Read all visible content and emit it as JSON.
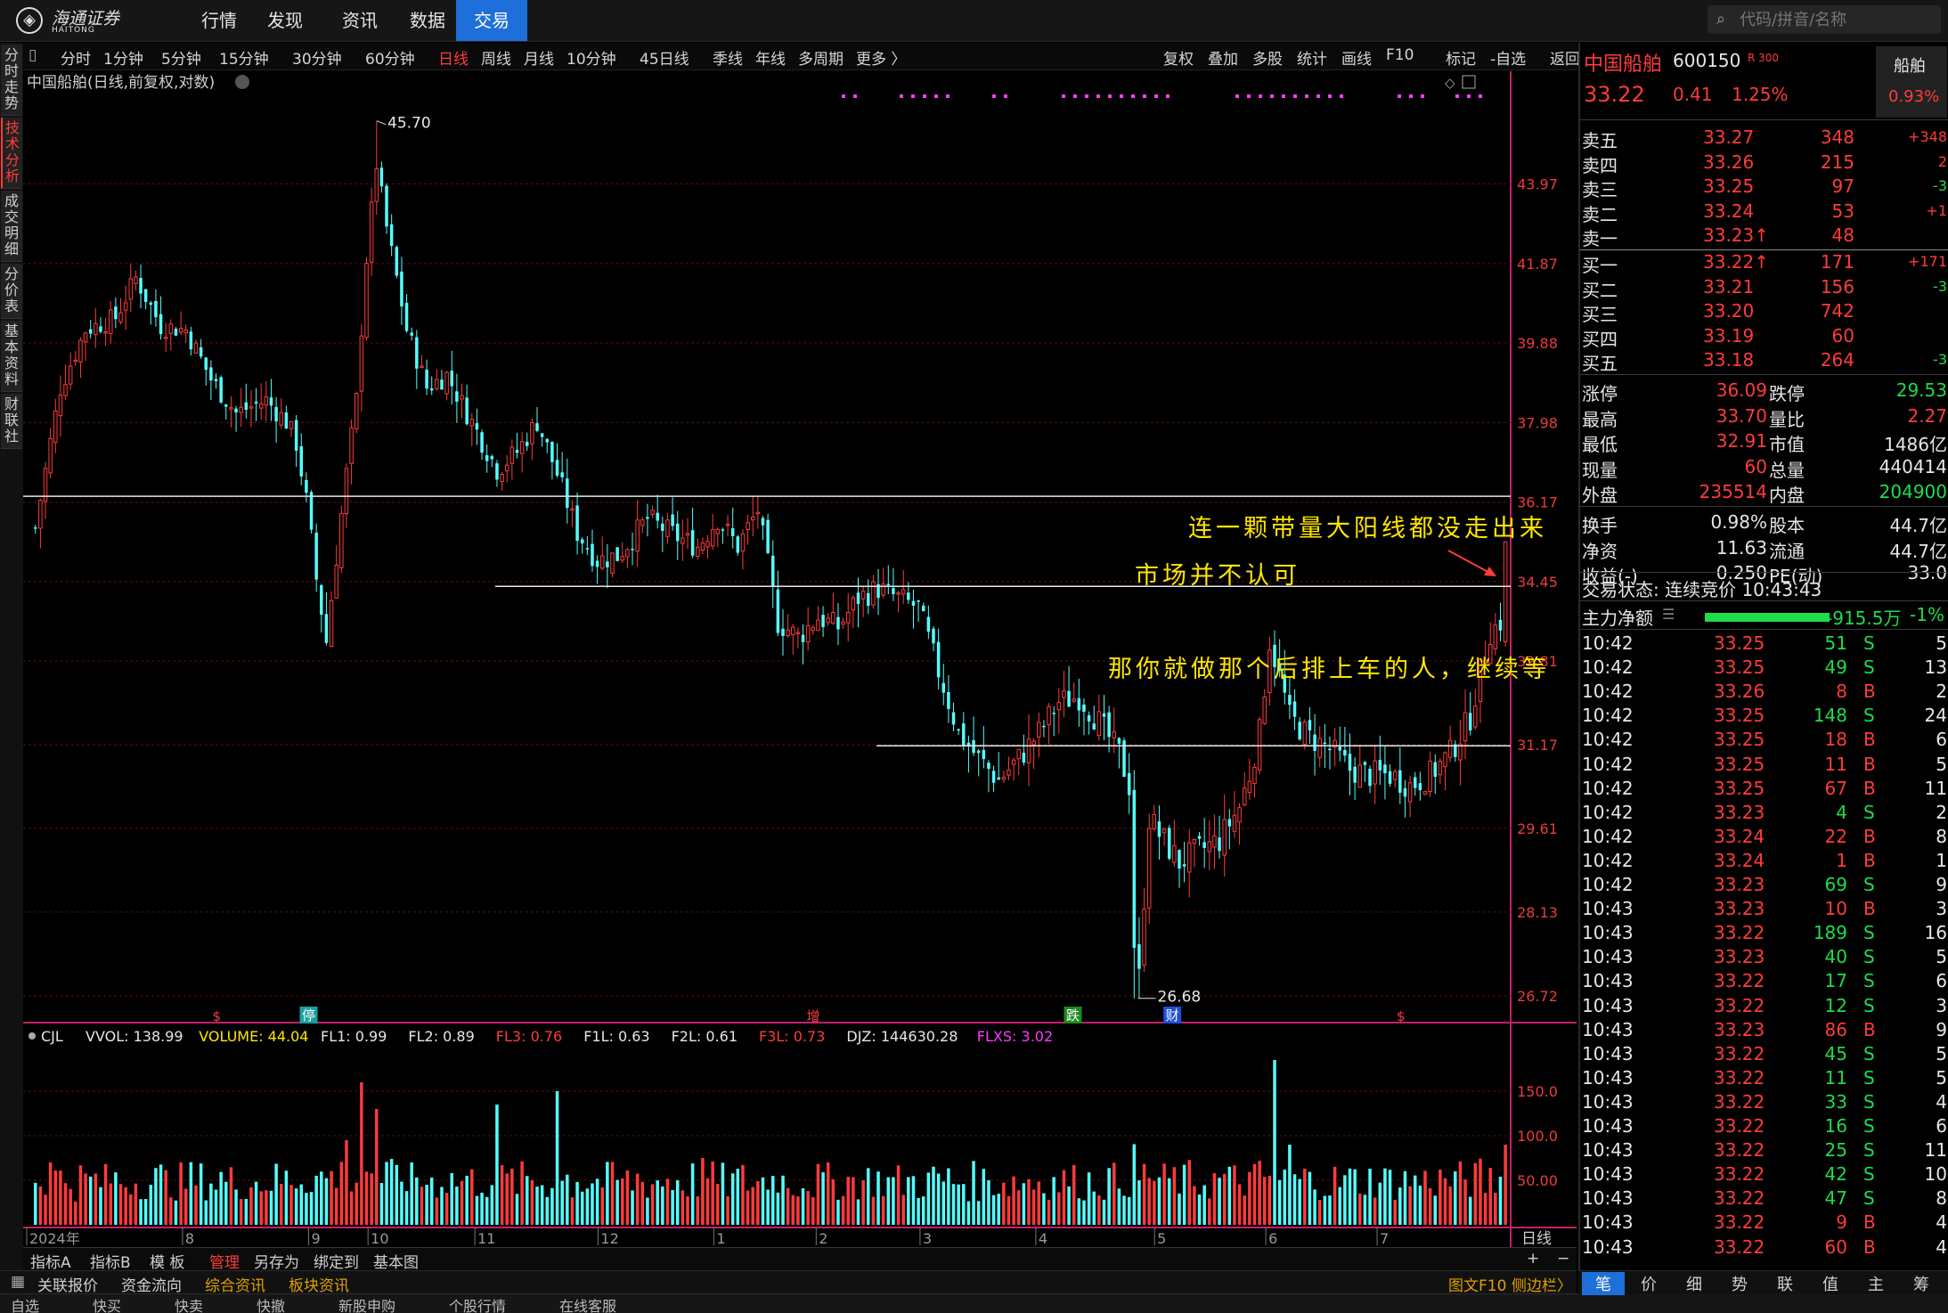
{
  "app": {
    "logo_cn": "海通证券",
    "logo_en": "HAITONG",
    "nav": [
      "行情",
      "发现",
      "资讯",
      "数据",
      "交易"
    ],
    "active_nav": 4,
    "search_placeholder": "代码/拼音/名称"
  },
  "left_tabs": [
    {
      "label": "分时走势",
      "active": false
    },
    {
      "label": "技术分析",
      "active": true
    },
    {
      "label": "成交明细",
      "active": false
    },
    {
      "label": "分价表",
      "active": false
    },
    {
      "label": "基本资料",
      "active": false
    },
    {
      "label": "财联社",
      "active": false
    }
  ],
  "period_toolbar": {
    "left": [
      "分时",
      "1分钟",
      "5分钟",
      "15分钟",
      "30分钟",
      "60分钟",
      "日线",
      "周线",
      "月线",
      "10分钟",
      "45日线",
      "季线",
      "年线",
      "多周期",
      "更多 〉"
    ],
    "active": "日线",
    "right": [
      "复权",
      "叠加",
      "多股",
      "统计",
      "画线",
      "F10",
      "标记",
      "-自选",
      "返回"
    ]
  },
  "chart_header": "中国船舶(日线,前复权,对数)",
  "price_axis": [
    "43.97",
    "41.87",
    "39.88",
    "37.98",
    "36.17",
    "34.45",
    "32.81",
    "31.17",
    "29.61",
    "28.13",
    "26.72"
  ],
  "high_label": "45.70",
  "low_label": "26.68",
  "h_lines": [
    36.3,
    34.35,
    31.15
  ],
  "signals": [
    {
      "text": "$",
      "x": 0.128,
      "kind": "red"
    },
    {
      "text": "停",
      "x": 0.19,
      "kind": "teal"
    },
    {
      "text": "增",
      "x": 0.53,
      "kind": "red"
    },
    {
      "text": "跌",
      "x": 0.705,
      "kind": "green"
    },
    {
      "text": "财",
      "x": 0.772,
      "kind": "blue"
    },
    {
      "text": "$",
      "x": 0.926,
      "kind": "red"
    }
  ],
  "annotations": [
    "连一颗带量大阳线都没走出来",
    "市场并不认可",
    "那你就做那个后排上车的人，继续等"
  ],
  "indicator": {
    "title": "CJL",
    "items": [
      {
        "label": "VVOL: 138.99",
        "color": "#e6e6e6"
      },
      {
        "label": "VOLUME: 44.04",
        "color": "#ffe600"
      },
      {
        "label": "FL1: 0.99",
        "color": "#e6e6e6"
      },
      {
        "label": "FL2: 0.89",
        "color": "#e6e6e6"
      },
      {
        "label": "FL3: 0.76",
        "color": "#ff3b3b"
      },
      {
        "label": "F1L: 0.63",
        "color": "#e6e6e6"
      },
      {
        "label": "F2L: 0.61",
        "color": "#e6e6e6"
      },
      {
        "label": "F3L: 0.73",
        "color": "#ff3b3b"
      },
      {
        "label": "DJZ: 144630.28",
        "color": "#e6e6e6"
      },
      {
        "label": "FLXS: 3.02",
        "color": "#ff3bff"
      }
    ],
    "axis": [
      "150.0",
      "100.0",
      "50.00"
    ]
  },
  "time_axis": [
    "2024年",
    "8",
    "9",
    "10",
    "11",
    "12",
    "1",
    "2",
    "3",
    "4",
    "5",
    "6",
    "7"
  ],
  "time_axis_right": "日线",
  "bottom_toolbar1": [
    "指标A",
    "指标B",
    "模 板",
    "管理",
    "另存为",
    "绑定到",
    "基本图"
  ],
  "bottom_toolbar1_active": "管理",
  "bottom_toolbar2": [
    "关联报价",
    "资金流向",
    "综合资讯",
    "板块资讯"
  ],
  "bottom_toolbar2_highlight": [
    "综合资讯",
    "板块资讯"
  ],
  "bottom_toolbar2_right": "图文F10  侧边栏〉",
  "bottom_toolbar3": [
    "自选",
    "快买",
    "快卖",
    "快撤",
    "新股申购",
    "个股行情",
    "在线客服"
  ],
  "quote": {
    "name": "中国船舶",
    "code": "600150",
    "tag": "R 300",
    "badge_name": "船舶",
    "price": "33.22",
    "change": "0.41",
    "pct": "1.25%",
    "badge_pct": "0.93%",
    "asks": [
      {
        "label": "卖五",
        "price": "33.27",
        "vol": "348",
        "chg": "+348",
        "chg_color": "red"
      },
      {
        "label": "卖四",
        "price": "33.26",
        "vol": "215",
        "chg": "2",
        "chg_color": "red"
      },
      {
        "label": "卖三",
        "price": "33.25",
        "vol": "97",
        "chg": "-3",
        "chg_color": "green"
      },
      {
        "label": "卖二",
        "price": "33.24",
        "vol": "53",
        "chg": "+1",
        "chg_color": "red"
      },
      {
        "label": "卖一",
        "price": "33.23↑",
        "vol": "48",
        "chg": "",
        "chg_color": "red"
      }
    ],
    "bids": [
      {
        "label": "买一",
        "price": "33.22↑",
        "vol": "171",
        "chg": "+171",
        "chg_color": "red"
      },
      {
        "label": "买二",
        "price": "33.21",
        "vol": "156",
        "chg": "-3",
        "chg_color": "green"
      },
      {
        "label": "买三",
        "price": "33.20",
        "vol": "742",
        "chg": "",
        "chg_color": "red"
      },
      {
        "label": "买四",
        "price": "33.19",
        "vol": "60",
        "chg": "",
        "chg_color": "red"
      },
      {
        "label": "买五",
        "price": "33.18",
        "vol": "264",
        "chg": "-3",
        "chg_color": "green"
      }
    ],
    "stats": [
      {
        "l1": "涨停",
        "v1": "36.09",
        "c1": "red",
        "l2": "跌停",
        "v2": "29.53",
        "c2": "green"
      },
      {
        "l1": "最高",
        "v1": "33.70",
        "c1": "red",
        "l2": "量比",
        "v2": "2.27",
        "c2": "red"
      },
      {
        "l1": "最低",
        "v1": "32.91",
        "c1": "red",
        "l2": "市值",
        "v2": "1486亿",
        "c2": "white"
      },
      {
        "l1": "现量",
        "v1": "60",
        "c1": "red",
        "l2": "总量",
        "v2": "440414",
        "c2": "white"
      },
      {
        "l1": "外盘",
        "v1": "235514",
        "c1": "red",
        "l2": "内盘",
        "v2": "204900",
        "c2": "green"
      }
    ],
    "stats2": [
      {
        "l1": "换手",
        "v1": "0.98%",
        "l2": "股本",
        "v2": "44.7亿"
      },
      {
        "l1": "净资",
        "v1": "11.63",
        "l2": "流通",
        "v2": "44.7亿"
      },
      {
        "l1": "收益(-)",
        "v1": "0.250",
        "l2": "PE(动)",
        "v2": "33.0"
      }
    ],
    "trade_status": "交易状态: 连续竞价 10:43:43",
    "main_flow_label": "主力净额",
    "main_flow_value": "-915.5万",
    "main_flow_pct": "-1%",
    "main_flow_fraction": 0.7
  },
  "ticks": [
    {
      "t": "10:42",
      "p": "33.25",
      "v": "51",
      "s": "S",
      "n": "5"
    },
    {
      "t": "10:42",
      "p": "33.25",
      "v": "49",
      "s": "S",
      "n": "13"
    },
    {
      "t": "10:42",
      "p": "33.26",
      "v": "8",
      "s": "B",
      "n": "2"
    },
    {
      "t": "10:42",
      "p": "33.25",
      "v": "148",
      "s": "S",
      "n": "24"
    },
    {
      "t": "10:42",
      "p": "33.25",
      "v": "18",
      "s": "B",
      "n": "6"
    },
    {
      "t": "10:42",
      "p": "33.25",
      "v": "11",
      "s": "B",
      "n": "5"
    },
    {
      "t": "10:42",
      "p": "33.25",
      "v": "67",
      "s": "B",
      "n": "11"
    },
    {
      "t": "10:42",
      "p": "33.23",
      "v": "4",
      "s": "S",
      "n": "2"
    },
    {
      "t": "10:42",
      "p": "33.24",
      "v": "22",
      "s": "B",
      "n": "8"
    },
    {
      "t": "10:42",
      "p": "33.24",
      "v": "1",
      "s": "B",
      "n": "1"
    },
    {
      "t": "10:42",
      "p": "33.23",
      "v": "69",
      "s": "S",
      "n": "9"
    },
    {
      "t": "10:43",
      "p": "33.23",
      "v": "10",
      "s": "B",
      "n": "3"
    },
    {
      "t": "10:43",
      "p": "33.22",
      "v": "189",
      "s": "S",
      "n": "16"
    },
    {
      "t": "10:43",
      "p": "33.23",
      "v": "40",
      "s": "S",
      "n": "5"
    },
    {
      "t": "10:43",
      "p": "33.22",
      "v": "17",
      "s": "S",
      "n": "6"
    },
    {
      "t": "10:43",
      "p": "33.22",
      "v": "12",
      "s": "S",
      "n": "3"
    },
    {
      "t": "10:43",
      "p": "33.23",
      "v": "86",
      "s": "B",
      "n": "9"
    },
    {
      "t": "10:43",
      "p": "33.22",
      "v": "45",
      "s": "S",
      "n": "5"
    },
    {
      "t": "10:43",
      "p": "33.22",
      "v": "11",
      "s": "S",
      "n": "5"
    },
    {
      "t": "10:43",
      "p": "33.22",
      "v": "33",
      "s": "S",
      "n": "4"
    },
    {
      "t": "10:43",
      "p": "33.22",
      "v": "16",
      "s": "S",
      "n": "6"
    },
    {
      "t": "10:43",
      "p": "33.22",
      "v": "25",
      "s": "S",
      "n": "11"
    },
    {
      "t": "10:43",
      "p": "33.22",
      "v": "42",
      "s": "S",
      "n": "10"
    },
    {
      "t": "10:43",
      "p": "33.22",
      "v": "47",
      "s": "S",
      "n": "8"
    },
    {
      "t": "10:43",
      "p": "33.22",
      "v": "9",
      "s": "B",
      "n": "4"
    },
    {
      "t": "10:43",
      "p": "33.22",
      "v": "60",
      "s": "B",
      "n": "4"
    }
  ],
  "right_tabs": [
    "笔",
    "价",
    "细",
    "势",
    "联",
    "值",
    "主",
    "筹"
  ],
  "right_tabs_active": 0,
  "colors": {
    "up": "#ff3b3b",
    "down": "#54ffff",
    "grid": "#5a1010",
    "accent": "#1e6fd9"
  },
  "chart_data": {
    "type": "candlestick",
    "ylim": [
      26.4,
      46.6
    ],
    "vol_ylim": [
      0,
      200
    ],
    "control_points": [
      [
        0,
        35.6
      ],
      [
        5,
        38.8
      ],
      [
        10,
        40.2
      ],
      [
        16,
        40.5
      ],
      [
        20,
        41.5
      ],
      [
        25,
        40.3
      ],
      [
        30,
        40.2
      ],
      [
        35,
        39.0
      ],
      [
        40,
        38.2
      ],
      [
        46,
        38.5
      ],
      [
        50,
        38.0
      ],
      [
        52,
        37.5
      ],
      [
        54,
        36.2
      ],
      [
        56,
        34.5
      ],
      [
        58,
        33.2
      ],
      [
        60,
        35.0
      ],
      [
        62,
        36.8
      ],
      [
        64,
        38.5
      ],
      [
        66,
        42.0
      ],
      [
        68,
        44.5
      ],
      [
        70,
        42.8
      ],
      [
        74,
        40.2
      ],
      [
        78,
        38.8
      ],
      [
        82,
        39.1
      ],
      [
        86,
        38.2
      ],
      [
        92,
        36.9
      ],
      [
        96,
        37.3
      ],
      [
        100,
        38.0
      ],
      [
        104,
        36.8
      ],
      [
        108,
        35.5
      ],
      [
        112,
        34.9
      ],
      [
        116,
        35.0
      ],
      [
        122,
        35.8
      ],
      [
        128,
        35.4
      ],
      [
        132,
        35.2
      ],
      [
        136,
        35.8
      ],
      [
        140,
        35.2
      ],
      [
        144,
        36.0
      ],
      [
        146,
        34.8
      ],
      [
        148,
        33.6
      ],
      [
        152,
        33.3
      ],
      [
        156,
        33.7
      ],
      [
        160,
        33.5
      ],
      [
        164,
        34.1
      ],
      [
        168,
        34.3
      ],
      [
        172,
        34.1
      ],
      [
        176,
        33.9
      ],
      [
        180,
        32.6
      ],
      [
        184,
        31.4
      ],
      [
        188,
        30.9
      ],
      [
        192,
        30.5
      ],
      [
        196,
        30.9
      ],
      [
        200,
        31.4
      ],
      [
        204,
        32.0
      ],
      [
        208,
        32.1
      ],
      [
        212,
        31.6
      ],
      [
        216,
        31.0
      ],
      [
        218,
        30.4
      ],
      [
        219,
        27.6
      ],
      [
        220,
        27.0
      ],
      [
        222,
        29.8
      ],
      [
        224,
        29.5
      ],
      [
        228,
        29.0
      ],
      [
        232,
        29.2
      ],
      [
        236,
        29.4
      ],
      [
        240,
        30.0
      ],
      [
        242,
        30.6
      ],
      [
        244,
        31.4
      ],
      [
        246,
        33.2
      ],
      [
        248,
        32.5
      ],
      [
        250,
        31.7
      ],
      [
        254,
        31.3
      ],
      [
        258,
        31.1
      ],
      [
        262,
        30.7
      ],
      [
        266,
        30.6
      ],
      [
        270,
        30.6
      ],
      [
        274,
        30.4
      ],
      [
        278,
        30.6
      ],
      [
        282,
        31.0
      ],
      [
        286,
        31.7
      ],
      [
        288,
        32.6
      ],
      [
        290,
        33.4
      ],
      [
        292,
        33.6
      ],
      [
        293,
        34.1
      ]
    ],
    "volume_spikes": [
      [
        3,
        70
      ],
      [
        62,
        95
      ],
      [
        65,
        160
      ],
      [
        68,
        130
      ],
      [
        92,
        135
      ],
      [
        104,
        150
      ],
      [
        133,
        75
      ],
      [
        247,
        185
      ],
      [
        250,
        90
      ]
    ]
  }
}
